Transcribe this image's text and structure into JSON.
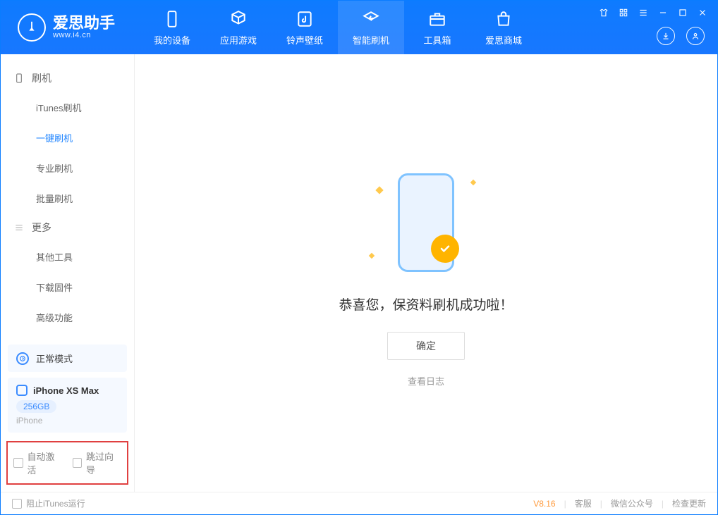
{
  "header": {
    "app_name": "爱思助手",
    "url": "www.i4.cn",
    "navs": [
      {
        "label": "我的设备",
        "icon": "device-icon"
      },
      {
        "label": "应用游戏",
        "icon": "cube-icon"
      },
      {
        "label": "铃声壁纸",
        "icon": "music-icon"
      },
      {
        "label": "智能刷机",
        "icon": "refresh-icon"
      },
      {
        "label": "工具箱",
        "icon": "toolbox-icon"
      },
      {
        "label": "爱思商城",
        "icon": "shop-icon"
      }
    ]
  },
  "sidebar": {
    "group1": {
      "title": "刷机"
    },
    "items1": [
      "iTunes刷机",
      "一键刷机",
      "专业刷机",
      "批量刷机"
    ],
    "group2": {
      "title": "更多"
    },
    "items2": [
      "其他工具",
      "下载固件",
      "高级功能"
    ],
    "mode": {
      "label": "正常模式"
    },
    "device": {
      "name": "iPhone XS Max",
      "storage": "256GB",
      "type": "iPhone"
    },
    "options": {
      "auto_activate": "自动激活",
      "skip_guide": "跳过向导"
    }
  },
  "main": {
    "success_text": "恭喜您，保资料刷机成功啦！",
    "ok_label": "确定",
    "view_log": "查看日志"
  },
  "statusbar": {
    "block_itunes": "阻止iTunes运行",
    "version": "V8.16",
    "links": [
      "客服",
      "微信公众号",
      "检查更新"
    ]
  }
}
